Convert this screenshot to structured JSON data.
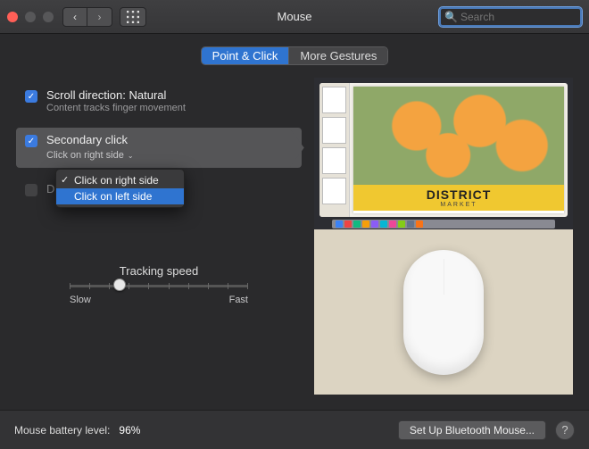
{
  "window": {
    "title": "Mouse"
  },
  "search": {
    "placeholder": "Search"
  },
  "tabs": {
    "active": "Point & Click",
    "other": "More Gestures"
  },
  "options": {
    "scroll": {
      "title": "Scroll direction: Natural",
      "sub": "Content tracks finger movement",
      "checked": true
    },
    "secondary": {
      "title": "Secondary click",
      "sub": "Click on right side",
      "checked": true,
      "selected": true
    },
    "double_tap": {
      "title": "Double-tap with one finger",
      "checked": false
    }
  },
  "dropdown": {
    "items": [
      {
        "label": "Click on right side",
        "checked": true,
        "highlighted": false
      },
      {
        "label": "Click on left side",
        "checked": false,
        "highlighted": true
      }
    ]
  },
  "preview": {
    "poster_headline": "DISTRICT",
    "poster_sub": "MARKET"
  },
  "slider": {
    "label": "Tracking speed",
    "min_label": "Slow",
    "max_label": "Fast",
    "value_pct": 28
  },
  "footer": {
    "battery_label": "Mouse battery level:",
    "battery_pct": "96%",
    "bt_button": "Set Up Bluetooth Mouse..."
  }
}
